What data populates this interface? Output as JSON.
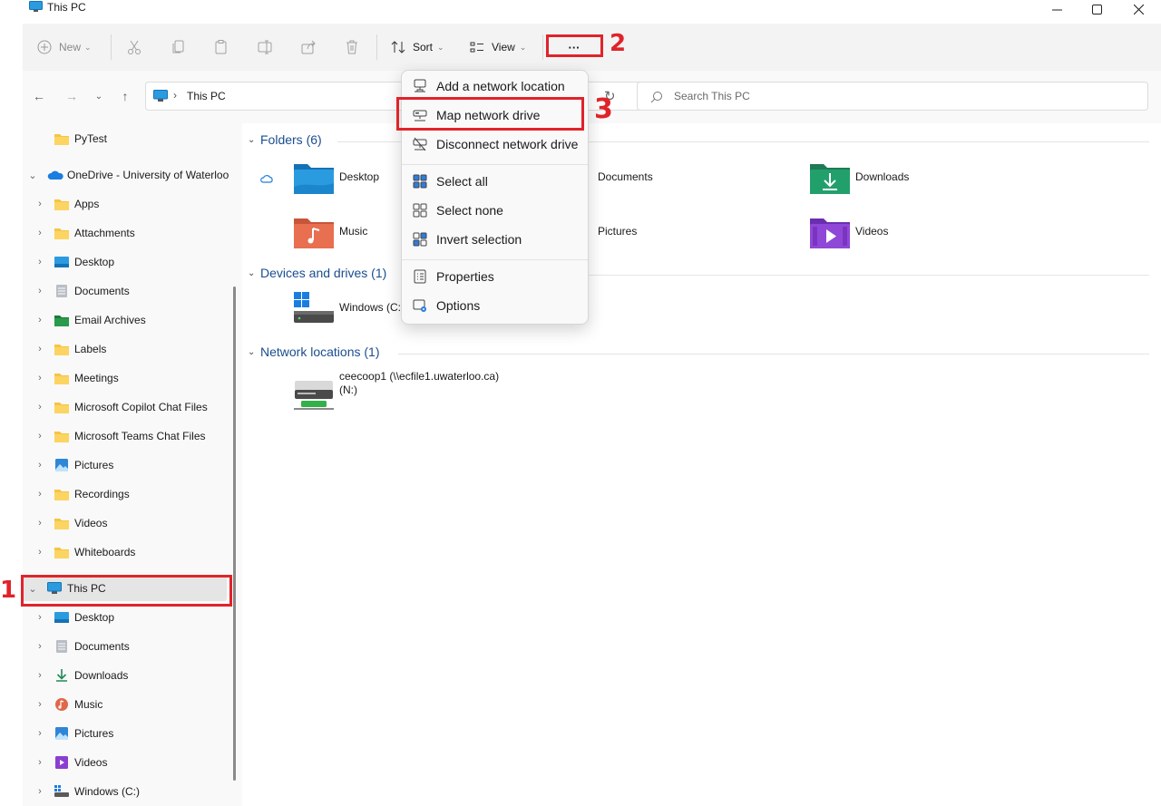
{
  "window": {
    "title": "This PC"
  },
  "toolbar": {
    "new_label": "New",
    "sort_label": "Sort",
    "view_label": "View",
    "more_label": "···"
  },
  "address": {
    "location": "This PC",
    "search_placeholder": "Search This PC"
  },
  "sidebar": {
    "top_items": [
      {
        "label": "PyTest"
      },
      {
        "label": "OneDrive - University of Waterloo"
      }
    ],
    "onedrive_items": [
      {
        "label": "Apps"
      },
      {
        "label": "Attachments"
      },
      {
        "label": "Desktop"
      },
      {
        "label": "Documents"
      },
      {
        "label": "Email Archives"
      },
      {
        "label": "Labels"
      },
      {
        "label": "Meetings"
      },
      {
        "label": "Microsoft Copilot Chat Files"
      },
      {
        "label": "Microsoft Teams Chat Files"
      },
      {
        "label": "Pictures"
      },
      {
        "label": "Recordings"
      },
      {
        "label": "Videos"
      },
      {
        "label": "Whiteboards"
      }
    ],
    "this_pc": {
      "label": "This PC"
    },
    "this_pc_items": [
      {
        "label": "Desktop"
      },
      {
        "label": "Documents"
      },
      {
        "label": "Downloads"
      },
      {
        "label": "Music"
      },
      {
        "label": "Pictures"
      },
      {
        "label": "Videos"
      },
      {
        "label": "Windows (C:)"
      }
    ]
  },
  "content": {
    "folders_header": "Folders (6)",
    "folders": [
      {
        "label": "Desktop"
      },
      {
        "label": "Documents"
      },
      {
        "label": "Downloads"
      },
      {
        "label": "Music"
      },
      {
        "label": "Pictures"
      },
      {
        "label": "Videos"
      }
    ],
    "devices_header": "Devices and drives (1)",
    "drive_label": "Windows (C:",
    "network_header": "Network locations (1)",
    "network_line1": "ceecoop1 (\\\\ecfile1.uwaterloo.ca)",
    "network_line2": "(N:)"
  },
  "menu": {
    "items": [
      {
        "label": "Add a network location",
        "icon": "network-location-icon"
      },
      {
        "label": "Map network drive",
        "icon": "map-drive-icon"
      },
      {
        "label": "Disconnect network drive",
        "icon": "disconnect-drive-icon"
      },
      {
        "label": "Select all",
        "icon": "select-all-icon"
      },
      {
        "label": "Select none",
        "icon": "select-none-icon"
      },
      {
        "label": "Invert selection",
        "icon": "invert-selection-icon"
      },
      {
        "label": "Properties",
        "icon": "properties-icon"
      },
      {
        "label": "Options",
        "icon": "options-icon"
      }
    ]
  },
  "annotations": {
    "step1": "1",
    "step2": "2",
    "step3": "3"
  },
  "colors": {
    "accent": "#1a4d8f",
    "annotation": "#e0232a",
    "selected_bg": "#e5e5e5"
  }
}
